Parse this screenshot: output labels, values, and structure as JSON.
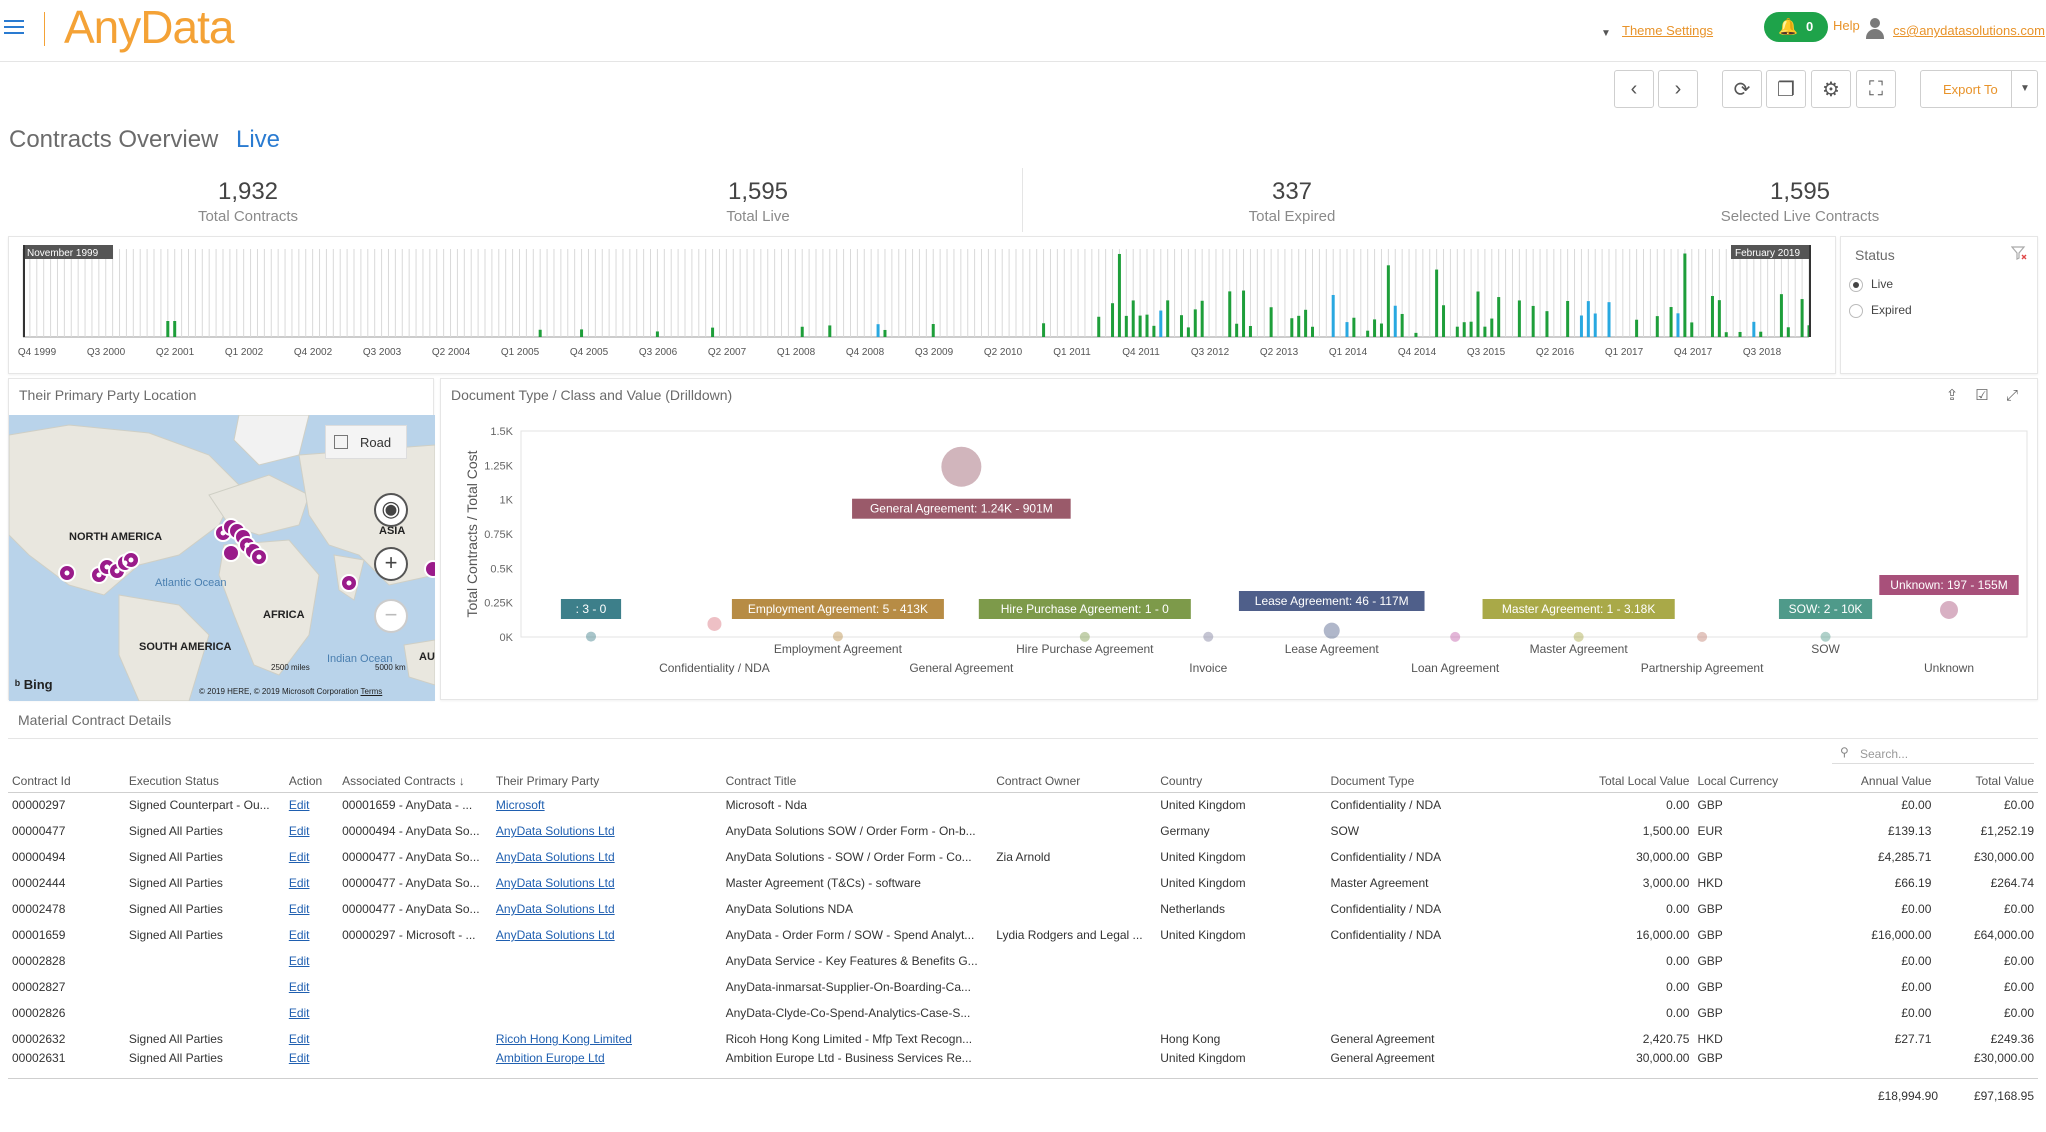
{
  "header": {
    "logo": "AnyData",
    "theme_settings": "Theme Settings",
    "notifications": "0",
    "help": "Help",
    "user_email": "cs@anydatasolutions.com"
  },
  "toolbar": {
    "export_label": "Export To"
  },
  "page": {
    "title": "Contracts Overview",
    "live_label": "Live"
  },
  "kpis": [
    {
      "value": "1,932",
      "label": "Total Contracts"
    },
    {
      "value": "1,595",
      "label": "Total Live"
    },
    {
      "value": "337",
      "label": "Total Expired"
    },
    {
      "value": "1,595",
      "label": "Selected Live Contracts"
    }
  ],
  "timeline": {
    "start_label": "November 1999",
    "end_label": "February 2019",
    "ticks": [
      "Q4 1999",
      "Q3 2000",
      "Q2 2001",
      "Q1 2002",
      "Q4 2002",
      "Q3 2003",
      "Q2 2004",
      "Q1 2005",
      "Q4 2005",
      "Q3 2006",
      "Q2 2007",
      "Q1 2008",
      "Q4 2008",
      "Q3 2009",
      "Q2 2010",
      "Q1 2011",
      "Q4 2011",
      "Q3 2012",
      "Q2 2013",
      "Q1 2014",
      "Q4 2014",
      "Q3 2015",
      "Q2 2016",
      "Q1 2017",
      "Q4 2017",
      "Q3 2018"
    ],
    "green_color": "#1e9e3a",
    "blue_color": "#29a8e0"
  },
  "status_filter": {
    "title": "Status",
    "options": [
      {
        "label": "Live",
        "checked": true
      },
      {
        "label": "Expired",
        "checked": false
      }
    ]
  },
  "map": {
    "title": "Their Primary Party Location",
    "road_label": "Road",
    "labels": {
      "north_america": "NORTH AMERICA",
      "south_america": "SOUTH AMERICA",
      "africa": "AFRICA",
      "asia": "ASIA",
      "au": "AU",
      "atlantic": "Atlantic Ocean",
      "indian": "Indian Ocean"
    },
    "bing": "Bing",
    "scale_miles": "2500 miles",
    "scale_km": "5000 km",
    "copyright": "© 2019 HERE, © 2019 Microsoft Corporation",
    "terms": "Terms"
  },
  "chart_data": {
    "type": "scatter",
    "title": "Document Type / Class and Value (Drilldown)",
    "ylabel": "Total Contracts / Total Cost",
    "ylim": [
      0,
      1500
    ],
    "y_ticks": [
      "0K",
      "0.25K",
      "0.5K",
      "0.75K",
      "1K",
      "1.25K",
      "1.5K"
    ],
    "categories": [
      "Confidentiality / NDA",
      "Employment Agreement",
      "General Agreement",
      "Hire Purchase Agreement",
      "Invoice",
      "Lease Agreement",
      "Loan Agreement",
      "Master Agreement",
      "Partnership Agreement",
      "SOW",
      "Unknown"
    ],
    "points": [
      {
        "category": "",
        "y": 3,
        "label": ": 3 - 0",
        "color": "#3d7f8a"
      },
      {
        "category": "Confidentiality / NDA",
        "y": 95,
        "label": "",
        "color": "#d9747e"
      },
      {
        "category": "Employment Agreement",
        "y": 5,
        "label": "Employment Agreement: 5 - 413K",
        "color": "#b78c45"
      },
      {
        "category": "General Agreement",
        "y": 1240,
        "label": "General Agreement: 1.24K - 901M",
        "color": "#9a5a6a"
      },
      {
        "category": "Hire Purchase Agreement",
        "y": 1,
        "label": "Hire Purchase Agreement: 1 - 0",
        "color": "#7d9a4a"
      },
      {
        "category": "Invoice",
        "y": 2,
        "label": "",
        "color": "#7f7f9e"
      },
      {
        "category": "Lease Agreement",
        "y": 46,
        "label": "Lease Agreement: 46 - 117M",
        "color": "#4f5f8a"
      },
      {
        "category": "Loan Agreement",
        "y": 1,
        "label": "",
        "color": "#c05ea8"
      },
      {
        "category": "Master Agreement",
        "y": 1,
        "label": "Master Agreement: 1 - 3.18K",
        "color": "#a9a948"
      },
      {
        "category": "Partnership Agreement",
        "y": 1,
        "label": "",
        "color": "#c08070"
      },
      {
        "category": "SOW",
        "y": 2,
        "label": "SOW: 2 - 10K",
        "color": "#4f9a8a"
      },
      {
        "category": "Unknown",
        "y": 197,
        "label": "Unknown: 197 - 155M",
        "color": "#a8507a"
      }
    ]
  },
  "table": {
    "title": "Material Contract Details",
    "search_placeholder": "Search...",
    "columns": [
      "Contract Id",
      "Execution Status",
      "Action",
      "Associated Contracts",
      "Their Primary Party",
      "Contract Title",
      "Contract Owner",
      "Country",
      "Document Type",
      "Total Local Value",
      "Local Currency",
      "Annual Value",
      "Total Value"
    ],
    "rows": [
      [
        "00000297",
        "Signed Counterpart - Ou...",
        "Edit",
        "00001659 - AnyData - ...",
        "Microsoft",
        "Microsoft - Nda",
        "",
        "United Kingdom",
        "Confidentiality / NDA",
        "0.00",
        "GBP",
        "£0.00",
        "£0.00"
      ],
      [
        "00000477",
        "Signed All Parties",
        "Edit",
        "00000494 - AnyData So...",
        "AnyData Solutions Ltd",
        "AnyData Solutions SOW / Order Form - On-b...",
        "",
        "Germany",
        "SOW",
        "1,500.00",
        "EUR",
        "£139.13",
        "£1,252.19"
      ],
      [
        "00000494",
        "Signed All Parties",
        "Edit",
        "00000477 - AnyData So...",
        "AnyData Solutions Ltd",
        "AnyData Solutions - SOW / Order Form - Co...",
        "Zia Arnold",
        "United Kingdom",
        "Confidentiality / NDA",
        "30,000.00",
        "GBP",
        "£4,285.71",
        "£30,000.00"
      ],
      [
        "00002444",
        "Signed All Parties",
        "Edit",
        "00000477 - AnyData So...",
        "AnyData Solutions Ltd",
        "Master Agreement (T&Cs) - software",
        "",
        "United Kingdom",
        "Master Agreement",
        "3,000.00",
        "HKD",
        "£66.19",
        "£264.74"
      ],
      [
        "00002478",
        "Signed All Parties",
        "Edit",
        "00000477 - AnyData So...",
        "AnyData Solutions Ltd",
        "AnyData Solutions NDA",
        "",
        "Netherlands",
        "Confidentiality / NDA",
        "0.00",
        "GBP",
        "£0.00",
        "£0.00"
      ],
      [
        "00001659",
        "Signed All Parties",
        "Edit",
        "00000297 - Microsoft - ...",
        "AnyData Solutions Ltd",
        "AnyData - Order Form / SOW - Spend Analyt...",
        "Lydia Rodgers and Legal ...",
        "United Kingdom",
        "Confidentiality / NDA",
        "16,000.00",
        "GBP",
        "£16,000.00",
        "£64,000.00"
      ],
      [
        "00002828",
        "",
        "Edit",
        "",
        "",
        "AnyData Service - Key Features & Benefits G...",
        "",
        "",
        "",
        "0.00",
        "GBP",
        "£0.00",
        "£0.00"
      ],
      [
        "00002827",
        "",
        "Edit",
        "",
        "",
        "AnyData-inmarsat-Supplier-On-Boarding-Ca...",
        "",
        "",
        "",
        "0.00",
        "GBP",
        "£0.00",
        "£0.00"
      ],
      [
        "00002826",
        "",
        "Edit",
        "",
        "",
        "AnyData-Clyde-Co-Spend-Analytics-Case-S...",
        "",
        "",
        "",
        "0.00",
        "GBP",
        "£0.00",
        "£0.00"
      ],
      [
        "00002632",
        "Signed All Parties",
        "Edit",
        "",
        "Ricoh Hong Kong Limited",
        "Ricoh Hong Kong Limited - Mfp Text Recogn...",
        "",
        "Hong Kong",
        "General Agreement",
        "2,420.75",
        "HKD",
        "£27.71",
        "£249.36"
      ],
      [
        "00002631",
        "Signed All Parties",
        "Edit",
        "",
        "Ambition Europe Ltd",
        "Ambition Europe Ltd - Business Services Re...",
        "",
        "United Kingdom",
        "General Agreement",
        "30,000.00",
        "GBP",
        "",
        "£30,000.00"
      ]
    ],
    "totals": {
      "annual": "£18,994.90",
      "total": "£97,168.95"
    }
  }
}
